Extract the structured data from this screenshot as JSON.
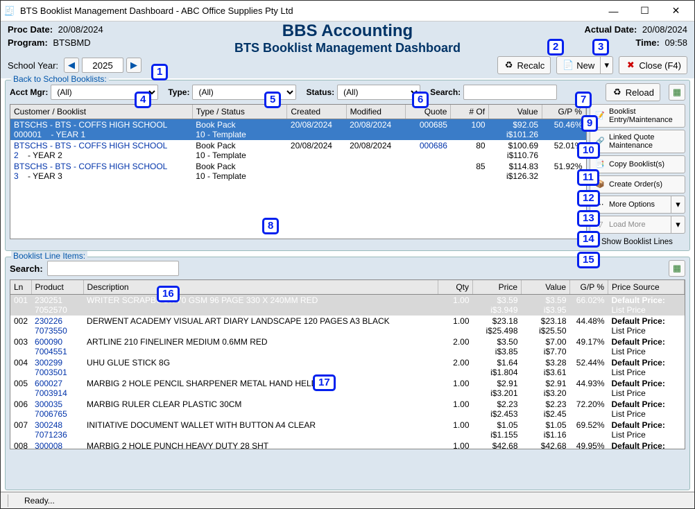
{
  "window": {
    "title": "BTS Booklist Management Dashboard - ABC Office Supplies Pty Ltd"
  },
  "header": {
    "proc_date_label": "Proc Date:",
    "proc_date": "20/08/2024",
    "program_label": "Program:",
    "program": "BTSBMD",
    "app_title": "BBS Accounting",
    "app_subtitle": "BTS Booklist Management Dashboard",
    "actual_date_label": "Actual Date:",
    "actual_date": "20/08/2024",
    "time_label": "Time:",
    "time": "09:58"
  },
  "toolbar": {
    "school_year_label": "School Year:",
    "school_year": "2025",
    "recalc": "Recalc",
    "new": "New",
    "close": "Close (F4)"
  },
  "filters": {
    "legend": "Back to School Booklists:",
    "acct_mgr_label": "Acct Mgr:",
    "acct_mgr": "(All)",
    "type_label": "Type:",
    "type": "(All)",
    "status_label": "Status:",
    "status": "(All)",
    "search_label": "Search:",
    "search": "",
    "reload": "Reload"
  },
  "grid_headers": {
    "customer": "Customer / Booklist",
    "type_status": "Type / Status",
    "created": "Created",
    "modified": "Modified",
    "quote": "Quote",
    "nof": "# Of",
    "value": "Value",
    "gp": "G/P %"
  },
  "booklists": [
    {
      "cust": "BTSCHS - BTS - COFFS HIGH SCHOOL",
      "code": "000001",
      "year": "- YEAR 1",
      "type": "Book Pack",
      "status": "10 - Template",
      "created": "20/08/2024",
      "modified": "20/08/2024",
      "quote": "000685",
      "nof": "100",
      "value": "$92.05",
      "value2": "i$101.26",
      "gp": "50.46%",
      "sel": true
    },
    {
      "cust": "BTSCHS - BTS - COFFS HIGH SCHOOL",
      "code": "2",
      "year": "- YEAR 2",
      "type": "Book Pack",
      "status": "10 - Template",
      "created": "20/08/2024",
      "modified": "20/08/2024",
      "quote": "000686",
      "nof": "80",
      "value": "$100.69",
      "value2": "i$110.76",
      "gp": "52.01%",
      "sel": false
    },
    {
      "cust": "BTSCHS - BTS - COFFS HIGH SCHOOL",
      "code": "3",
      "year": "- YEAR 3",
      "type": "Book Pack",
      "status": "10 - Template",
      "created": "",
      "modified": "",
      "quote": "",
      "nof": "85",
      "value": "$114.83",
      "value2": "i$126.32",
      "gp": "51.92%",
      "sel": false
    }
  ],
  "sidebar": {
    "booklist_entry": "Booklist Entry/Maintenance",
    "linked_quote": "Linked Quote Maintenance",
    "copy": "Copy Booklist(s)",
    "create_order": "Create Order(s)",
    "more": "More Options",
    "load_more": "Load More",
    "show_lines": "Show Booklist Lines"
  },
  "lines_section": {
    "legend": "Booklist Line Items:",
    "search_label": "Search:",
    "search": ""
  },
  "lines_headers": {
    "ln": "Ln",
    "product": "Product",
    "description": "Description",
    "qty": "Qty",
    "price": "Price",
    "value": "Value",
    "gp": "G/P %",
    "ps": "Price Source"
  },
  "lines": [
    {
      "ln": "001",
      "p1": "230251",
      "p2": "7052570",
      "desc": "WRITER SCRAPBOOK 70 GSM 96 PAGE 330 X 240MM RED",
      "qty": "1.00",
      "price": "$3.59",
      "price2": "i$3.949",
      "val": "$3.59",
      "val2": "i$3.95",
      "gp": "66.02%",
      "ps1": "Default Price:",
      "ps2": "List Price",
      "sel": true
    },
    {
      "ln": "002",
      "p1": "230226",
      "p2": "7073550",
      "desc": "DERWENT ACADEMY VISUAL ART DIARY LANDSCAPE 120 PAGES A3 BLACK",
      "qty": "1.00",
      "price": "$23.18",
      "price2": "i$25.498",
      "val": "$23.18",
      "val2": "i$25.50",
      "gp": "44.48%",
      "ps1": "Default Price:",
      "ps2": "List Price"
    },
    {
      "ln": "003",
      "p1": "600090",
      "p2": "7004551",
      "desc": "ARTLINE 210 FINELINER MEDIUM 0.6MM RED",
      "qty": "2.00",
      "price": "$3.50",
      "price2": "i$3.85",
      "val": "$7.00",
      "val2": "i$7.70",
      "gp": "49.17%",
      "ps1": "Default Price:",
      "ps2": "List Price"
    },
    {
      "ln": "004",
      "p1": "300299",
      "p2": "7003501",
      "desc": "UHU GLUE STICK 8G",
      "qty": "2.00",
      "price": "$1.64",
      "price2": "i$1.804",
      "val": "$3.28",
      "val2": "i$3.61",
      "gp": "52.44%",
      "ps1": "Default Price:",
      "ps2": "List Price"
    },
    {
      "ln": "005",
      "p1": "600027",
      "p2": "7003914",
      "desc": "MARBIG 2 HOLE PENCIL SHARPENER METAL HAND HELD",
      "qty": "1.00",
      "price": "$2.91",
      "price2": "i$3.201",
      "val": "$2.91",
      "val2": "i$3.20",
      "gp": "44.93%",
      "ps1": "Default Price:",
      "ps2": "List Price"
    },
    {
      "ln": "006",
      "p1": "300035",
      "p2": "7006765",
      "desc": "MARBIG RULER CLEAR PLASTIC 30CM",
      "qty": "1.00",
      "price": "$2.23",
      "price2": "i$2.453",
      "val": "$2.23",
      "val2": "i$2.45",
      "gp": "72.20%",
      "ps1": "Default Price:",
      "ps2": "List Price"
    },
    {
      "ln": "007",
      "p1": "300248",
      "p2": "7071236",
      "desc": "INITIATIVE DOCUMENT WALLET WITH BUTTON A4 CLEAR",
      "qty": "1.00",
      "price": "$1.05",
      "price2": "i$1.155",
      "val": "$1.05",
      "val2": "i$1.16",
      "gp": "69.52%",
      "ps1": "Default Price:",
      "ps2": "List Price"
    },
    {
      "ln": "008",
      "p1": "300008",
      "p2": "",
      "desc": "MARBIG 2 HOLE PUNCH HEAVY DUTY 28 SHT",
      "qty": "1.00",
      "price": "$42.68",
      "price2": "",
      "val": "$42.68",
      "val2": "",
      "gp": "49.95%",
      "ps1": "Default Price:",
      "ps2": ""
    }
  ],
  "status": {
    "text": "Ready..."
  },
  "markers": [
    "1",
    "2",
    "3",
    "4",
    "5",
    "6",
    "7",
    "8",
    "9",
    "10",
    "11",
    "12",
    "13",
    "14",
    "15",
    "16",
    "17"
  ]
}
